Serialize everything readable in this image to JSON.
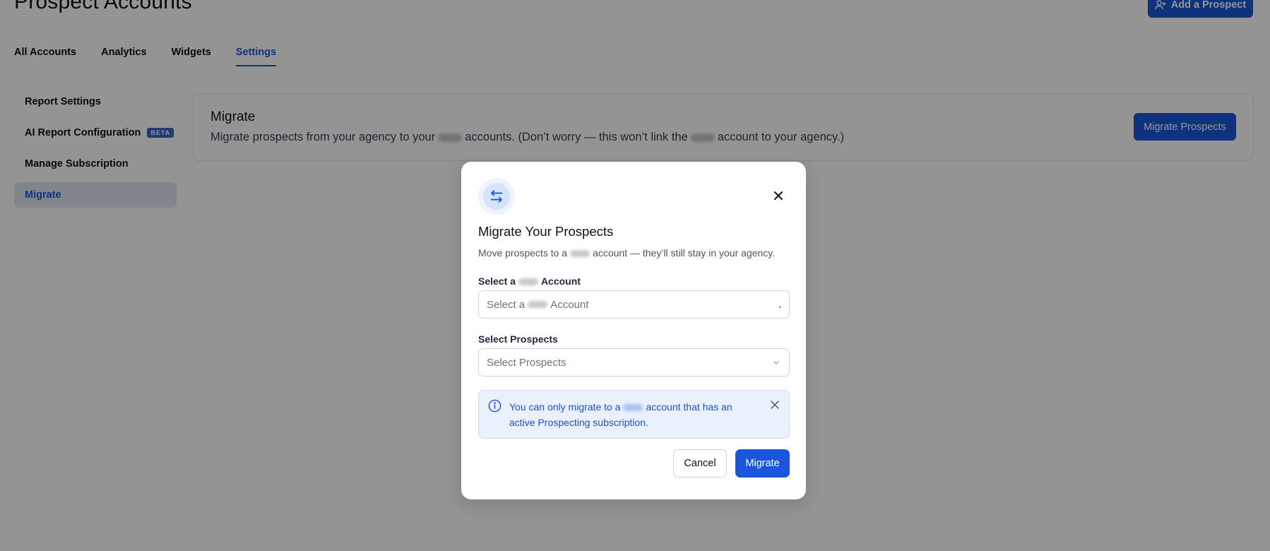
{
  "header": {
    "title": "Prospect Accounts",
    "add_button": "Add a Prospect",
    "add_icon": "user-plus-icon"
  },
  "tabs": [
    {
      "label": "All Accounts",
      "active": false
    },
    {
      "label": "Analytics",
      "active": false
    },
    {
      "label": "Widgets",
      "active": false
    },
    {
      "label": "Settings",
      "active": true
    }
  ],
  "sidebar": {
    "items": [
      {
        "label": "Report Settings"
      },
      {
        "label": "AI Report Configuration",
        "badge": "BETA"
      },
      {
        "label": "Manage Subscription"
      },
      {
        "label": "Migrate",
        "active": true
      }
    ]
  },
  "card": {
    "title": "Migrate",
    "desc_before": "Migrate prospects from your agency to your",
    "desc_middle": "accounts. (Don’t worry — this won’t link the",
    "desc_after": "account to your agency.)",
    "button": "Migrate Prospects"
  },
  "modal": {
    "icon": "swap-arrows-icon",
    "title": "Migrate Your Prospects",
    "subtitle_before": "Move prospects to a",
    "subtitle_after": "account — they’ll still stay in your agency.",
    "account_label_before": "Select a",
    "account_label_after": "Account",
    "account_placeholder_before": "Select a",
    "account_placeholder_after": "Account",
    "prospects_label": "Select Prospects",
    "prospects_placeholder": "Select Prospects",
    "alert_before": "You can only migrate to a",
    "alert_after": "account that has an active Prospecting subscription.",
    "cancel": "Cancel",
    "migrate": "Migrate"
  },
  "colors": {
    "accent": "#1a56db",
    "overlay": "rgba(0,0,0,0.42)",
    "alert_bg": "#eaf1fc"
  }
}
